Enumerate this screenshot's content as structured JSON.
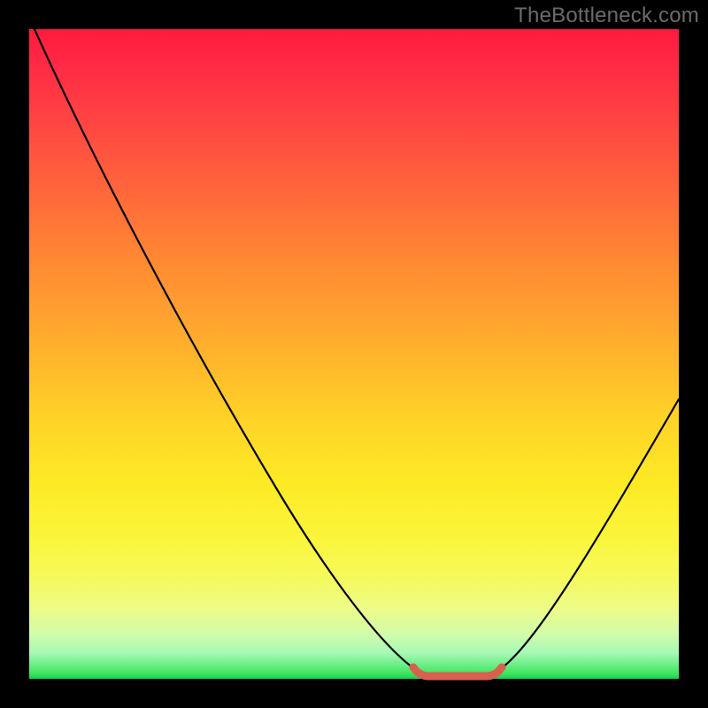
{
  "watermark": "TheBottleneck.com",
  "chart_data": {
    "type": "line",
    "title": "",
    "xlabel": "",
    "ylabel": "",
    "xlim": [
      0,
      100
    ],
    "ylim": [
      0,
      100
    ],
    "grid": false,
    "background": "red-to-green vertical gradient (bottleneck severity scale)",
    "series": [
      {
        "name": "bottleneck-curve",
        "x": [
          0,
          5,
          10,
          15,
          20,
          25,
          30,
          35,
          40,
          45,
          50,
          55,
          58,
          60,
          62,
          64,
          66,
          68,
          70,
          72,
          75,
          80,
          85,
          90,
          95,
          100
        ],
        "y": [
          100,
          92,
          84,
          76,
          68,
          60,
          52,
          44,
          36,
          28,
          20,
          12,
          7,
          4,
          2,
          1,
          0.5,
          0.5,
          1,
          2.5,
          5,
          11,
          18,
          26,
          34,
          43
        ]
      }
    ],
    "optimal_range_x": [
      60,
      72
    ],
    "annotations": [
      {
        "name": "optimal-marker",
        "type": "highlight",
        "x_start": 60,
        "x_end": 72,
        "color": "#d9604f"
      }
    ]
  }
}
